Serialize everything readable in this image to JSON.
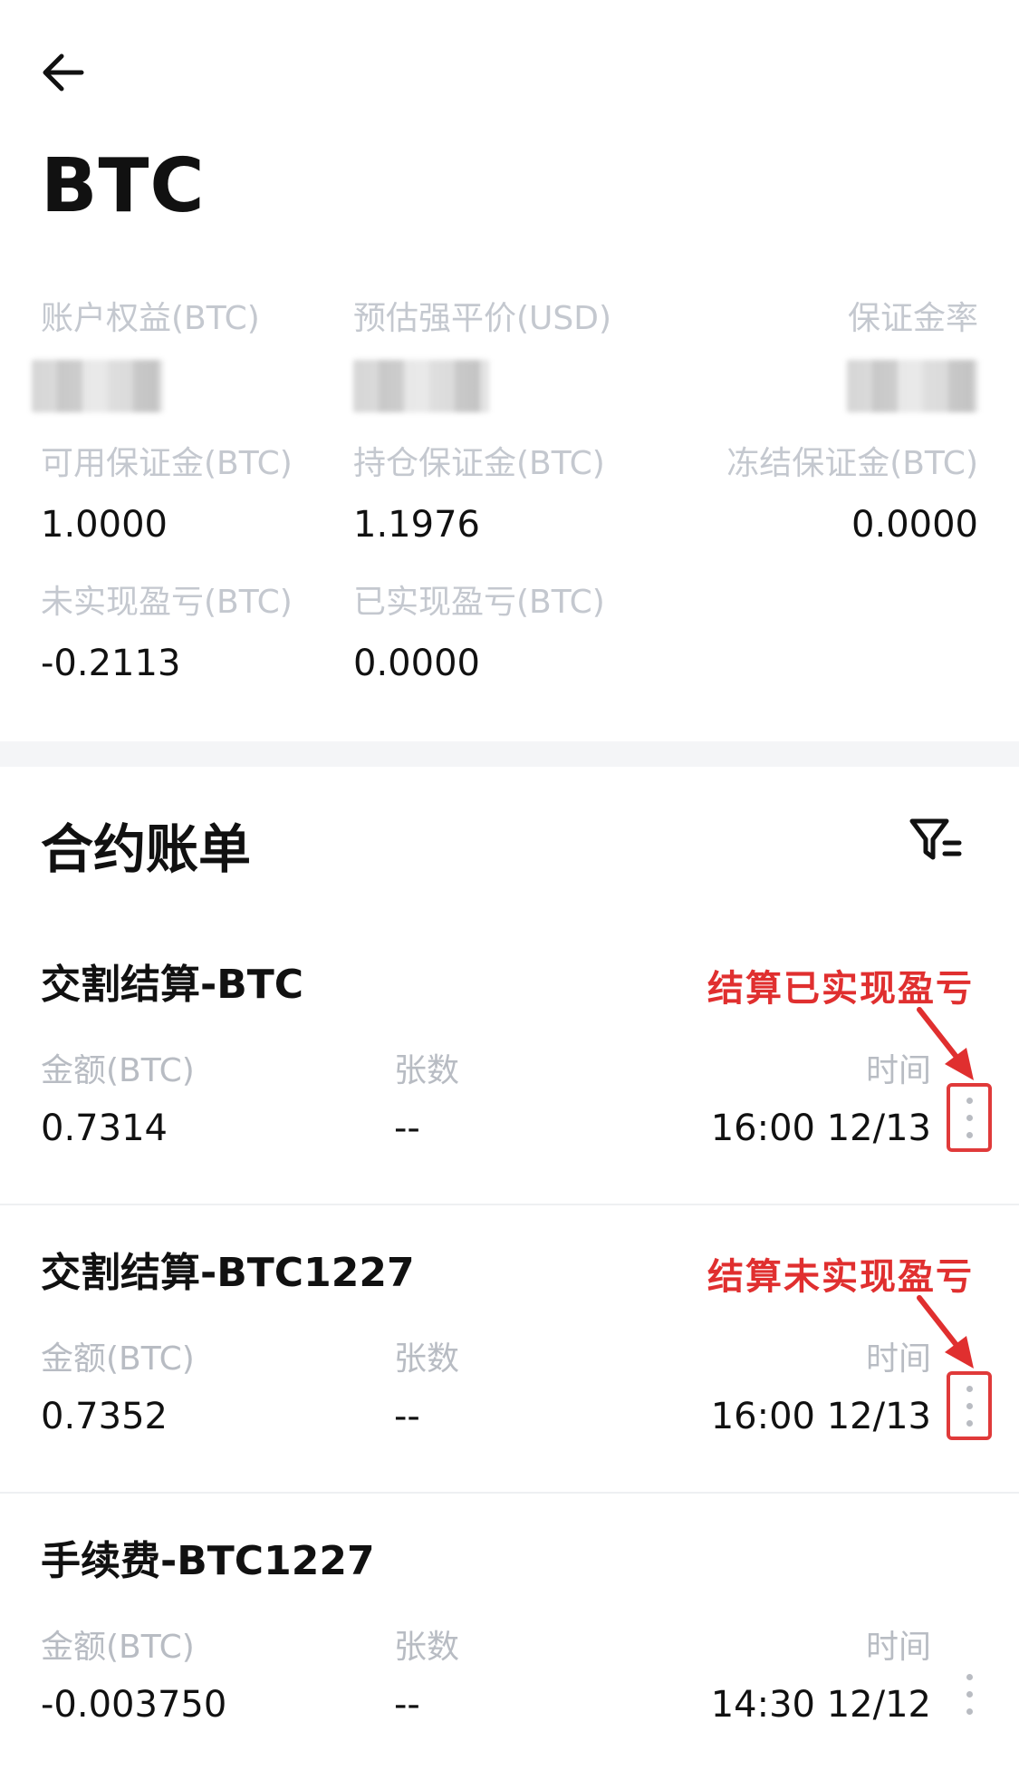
{
  "header": {
    "title": "BTC"
  },
  "summary": {
    "account_equity": {
      "label": "账户权益(BTC)"
    },
    "est_liquidation_price": {
      "label": "预估强平价(USD)"
    },
    "margin_ratio": {
      "label": "保证金率"
    },
    "available_margin": {
      "label": "可用保证金(BTC)",
      "value": "1.0000"
    },
    "position_margin": {
      "label": "持仓保证金(BTC)",
      "value": "1.1976"
    },
    "frozen_margin": {
      "label": "冻结保证金(BTC)",
      "value": "0.0000"
    },
    "unrealized_pnl": {
      "label": "未实现盈亏(BTC)",
      "value": "-0.2113"
    },
    "realized_pnl": {
      "label": "已实现盈亏(BTC)",
      "value": "0.0000"
    }
  },
  "bills": {
    "title": "合约账单",
    "items": [
      {
        "title": "交割结算-BTC",
        "amount_label": "金额(BTC)",
        "amount": "0.7314",
        "contracts_label": "张数",
        "contracts": "--",
        "time_label": "时间",
        "time": "16:00 12/13",
        "annotation": "结算已实现盈亏"
      },
      {
        "title": "交割结算-BTC1227",
        "amount_label": "金额(BTC)",
        "amount": "0.7352",
        "contracts_label": "张数",
        "contracts": "--",
        "time_label": "时间",
        "time": "16:00 12/13",
        "annotation": "结算未实现盈亏"
      },
      {
        "title": "手续费-BTC1227",
        "amount_label": "金额(BTC)",
        "amount": "-0.003750",
        "contracts_label": "张数",
        "contracts": "--",
        "time_label": "时间",
        "time": "14:30 12/12"
      }
    ]
  },
  "colors": {
    "annotation_red": "#e02f2f",
    "label_gray": "#c4c8cf",
    "text_primary": "#111111"
  },
  "icons": {
    "back": "arrow-left-icon",
    "filter": "filter-icon",
    "more": "more-vertical-icon"
  }
}
